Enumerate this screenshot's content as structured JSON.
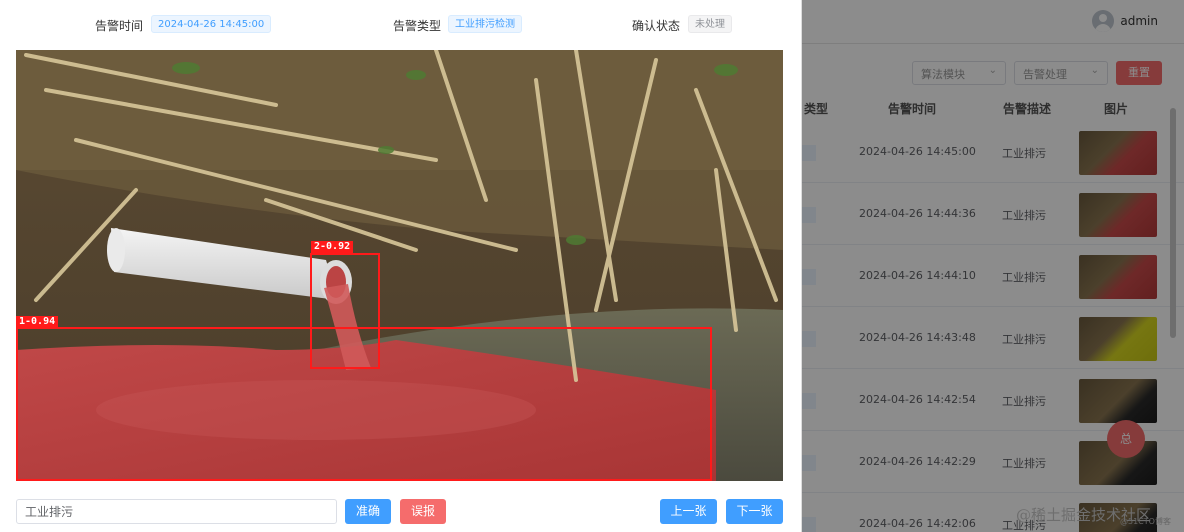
{
  "background": {
    "user": {
      "name": "admin"
    },
    "filters": [
      {
        "label": "算法模块"
      },
      {
        "label": "告警处理"
      }
    ],
    "reset_label": "重置",
    "table": {
      "columns": [
        "类型",
        "告警时间",
        "告警描述",
        "图片"
      ],
      "rows": [
        {
          "time": "2024-04-26 14:45:00",
          "desc": "工业排污"
        },
        {
          "time": "2024-04-26 14:44:36",
          "desc": "工业排污"
        },
        {
          "time": "2024-04-26 14:44:10",
          "desc": "工业排污"
        },
        {
          "time": "2024-04-26 14:43:48",
          "desc": "工业排污"
        },
        {
          "time": "2024-04-26 14:42:54",
          "desc": "工业排污"
        },
        {
          "time": "2024-04-26 14:42:29",
          "desc": "工业排污"
        },
        {
          "time": "2024-04-26 14:42:06",
          "desc": "工业排污"
        }
      ]
    },
    "fab_label": "总",
    "watermark": "@稀土掘金技术社区",
    "watermark_small": "@51CTO博客"
  },
  "dialog": {
    "alarm_time_label": "告警时间",
    "alarm_time_value": "2024-04-26 14:45:00",
    "alarm_type_label": "告警类型",
    "alarm_type_value": "工业排污检测",
    "confirm_status_label": "确认状态",
    "confirm_status_value": "未处理",
    "detections": [
      {
        "label": "2-0.92"
      },
      {
        "label": "1-0.94"
      }
    ],
    "description_value": "工业排污",
    "buttons": {
      "confirm": "准确",
      "false_alarm": "误报",
      "prev": "上一张",
      "next": "下一张"
    }
  },
  "colors": {
    "primary": "#409eff",
    "danger": "#f56c6c",
    "detection": "#ff1a1a"
  }
}
